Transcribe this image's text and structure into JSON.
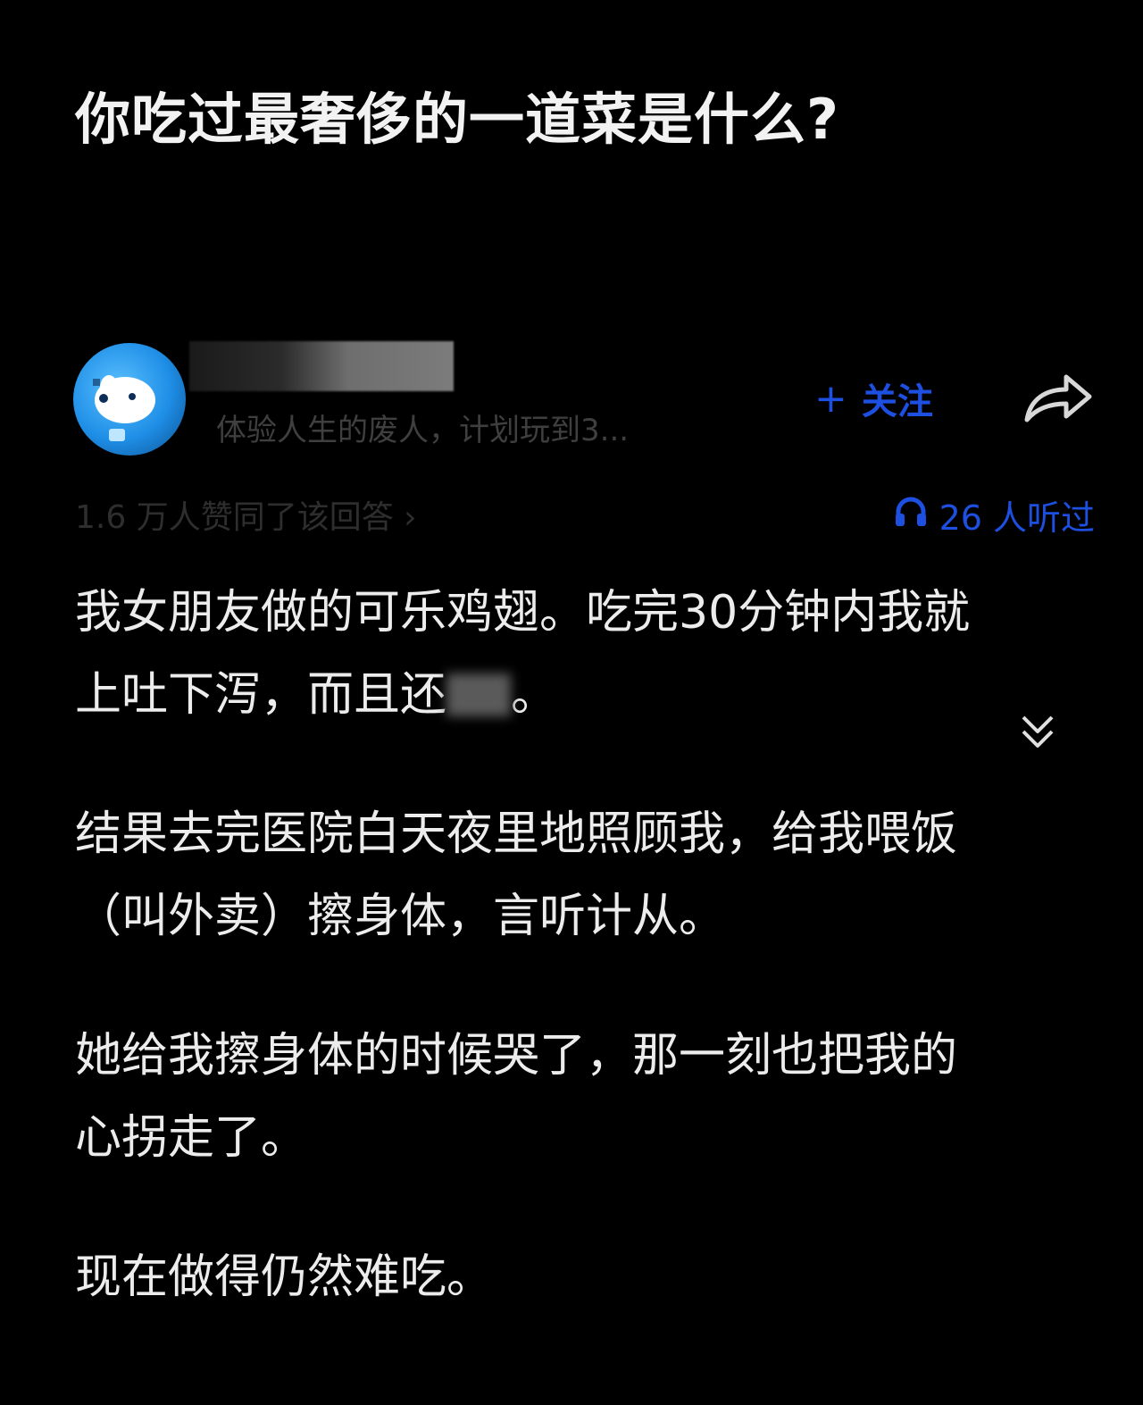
{
  "question": {
    "title": "你吃过最奢侈的一道菜是什么?"
  },
  "author": {
    "bio": "体验人生的废人，计划玩到3...",
    "follow_label": "关注",
    "follow_prefix": "+",
    "avatar_icon": "dog-avatar-icon",
    "share_icon": "share-arrow-icon"
  },
  "stats": {
    "upvotes": "1.6 万人赞同了该回答",
    "upvotes_chevron": "›",
    "listeners": "26 人听过",
    "listen_icon": "headphones-icon"
  },
  "answer": {
    "p1_line1": "我女朋友做的可乐鸡翅。吃完30分钟内我就",
    "p1_line2_a": "上吐下泻，而且还",
    "p1_line2_b": "。",
    "p2_line1": "结果去完医院白天夜里地照顾我，给我喂饭",
    "p2_line2": "（叫外卖）擦身体，言听计从。",
    "p3_line1": "她给我擦身体的时候哭了，那一刻也把我的",
    "p3_line2": "心拐走了。",
    "p4_line1": "现在做得仍然难吃。"
  },
  "colors": {
    "background": "#000000",
    "text": "#ececec",
    "accent": "#1d4fe0",
    "muted": "#3f3f3f"
  }
}
